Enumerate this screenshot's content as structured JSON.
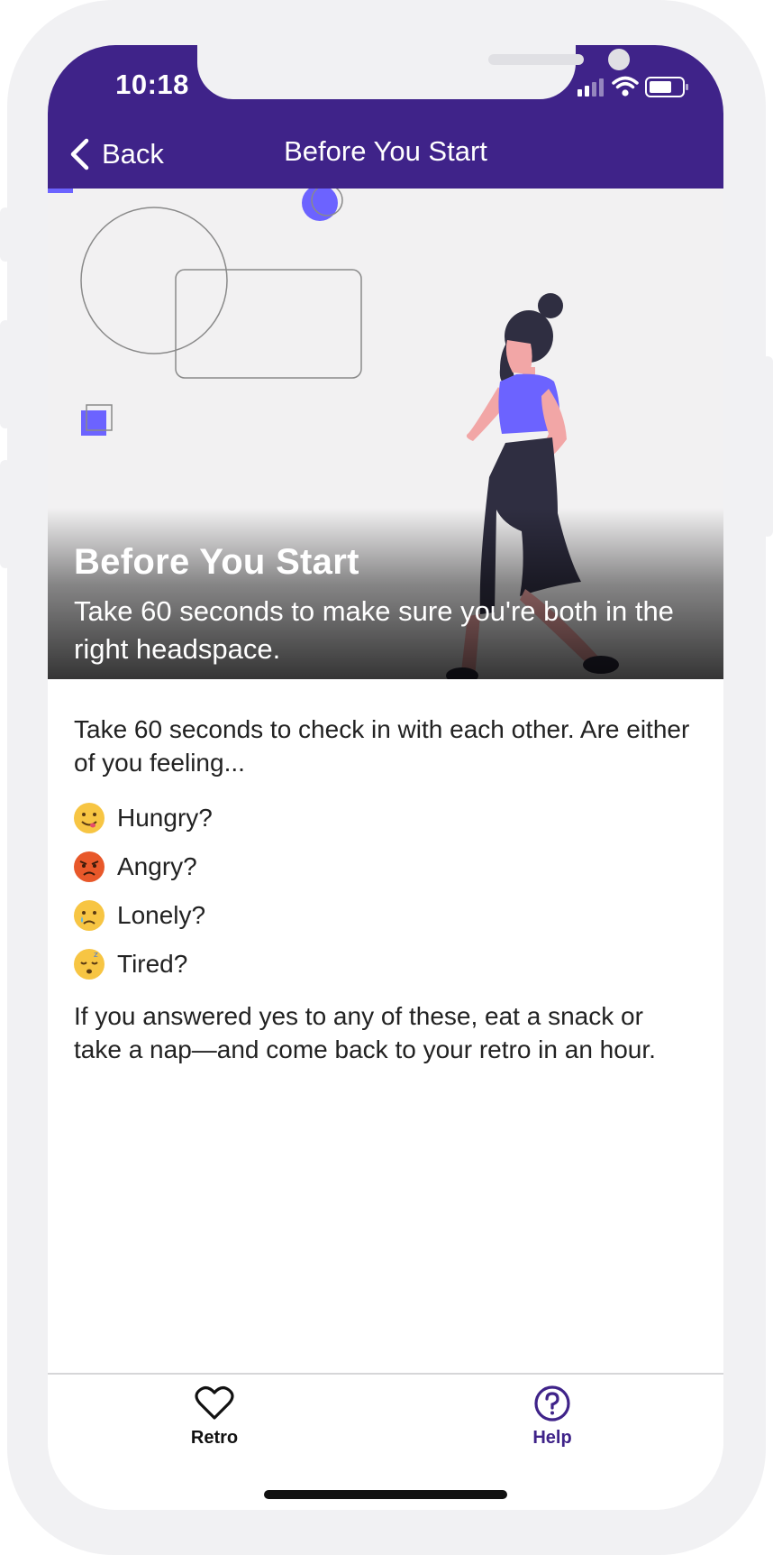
{
  "status_bar": {
    "time": "10:18"
  },
  "nav": {
    "back_label": "Back",
    "title": "Before You Start"
  },
  "hero": {
    "title": "Before You Start",
    "subtitle": "Take 60 seconds to make sure you're both in the right headspace."
  },
  "content": {
    "intro": "Take 60 seconds to check in with each other. Are either of you feeling...",
    "feelings": [
      {
        "label": "Hungry?",
        "icon": "yum-face-icon",
        "color": "#f7c543"
      },
      {
        "label": "Angry?",
        "icon": "angry-face-icon",
        "color": "#e8582a"
      },
      {
        "label": "Lonely?",
        "icon": "crying-face-icon",
        "color": "#f7c543"
      },
      {
        "label": "Tired?",
        "icon": "sleeping-face-icon",
        "color": "#f7c543"
      }
    ],
    "outro": "If you answered yes to any of these, eat a snack or take a nap—and come back to your retro in an hour."
  },
  "tabbar": {
    "tabs": [
      {
        "label": "Retro",
        "icon": "heart-icon",
        "active": false
      },
      {
        "label": "Help",
        "icon": "question-circle-icon",
        "active": true
      }
    ]
  },
  "colors": {
    "brand": "#3f2389",
    "accent": "#6c63ff"
  }
}
